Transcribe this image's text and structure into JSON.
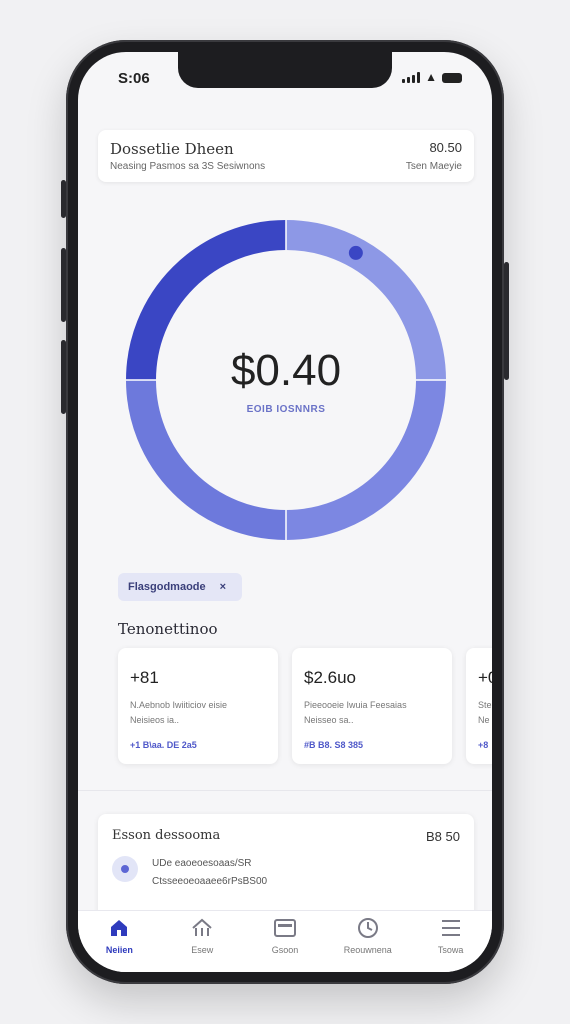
{
  "status_bar": {
    "time": "S:06"
  },
  "summary": {
    "title": "Dossetlie Dheen",
    "subtitle": "Neasing Pasmos sa 3S Sesiwnons",
    "amount": "80.50",
    "note": "Tsen Maeyie"
  },
  "donut": {
    "value": "$0.40",
    "label": "EOIB IOSNNRS",
    "colors": [
      "#3a46c4",
      "#8d98e6",
      "#6d79dc",
      "#7c87e2",
      "#5a66d6"
    ],
    "segments": [
      0.25,
      0.25,
      0.25,
      0.25
    ]
  },
  "filter_chip": {
    "label": "Flasgodmaode",
    "close": "×"
  },
  "section": {
    "title": "Tenonettinoo"
  },
  "stat_cards": [
    {
      "value": "+81",
      "desc1": "N.Aebnob Iwiiticiov eisie",
      "desc2": "Neisieos ia..",
      "meta": "+1 B\\aa. DE 2a5"
    },
    {
      "value": "$2.6uo",
      "desc1": "Pieeooeie Iwuia Feesaias",
      "desc2": "Neisseo sa..",
      "meta": "#B B8. S8 385"
    },
    {
      "value": "+0",
      "desc1": "Ste",
      "desc2": "Ne",
      "meta": "+8"
    }
  ],
  "transaction": {
    "title": "Esson dessooma",
    "amount": "B8 50",
    "line1": "UDe eaoeoesoaas/SR",
    "line2": "Ctsseeoeoaaee6rPsBS00"
  },
  "tabs": [
    {
      "label": "Neiien",
      "icon": "home-icon",
      "active": true
    },
    {
      "label": "Esew",
      "icon": "chart-icon",
      "active": false
    },
    {
      "label": "Gsoon",
      "icon": "card-icon",
      "active": false
    },
    {
      "label": "Reouwnena",
      "icon": "clock-icon",
      "active": false
    },
    {
      "label": "Tsowa",
      "icon": "menu-icon",
      "active": false
    }
  ]
}
